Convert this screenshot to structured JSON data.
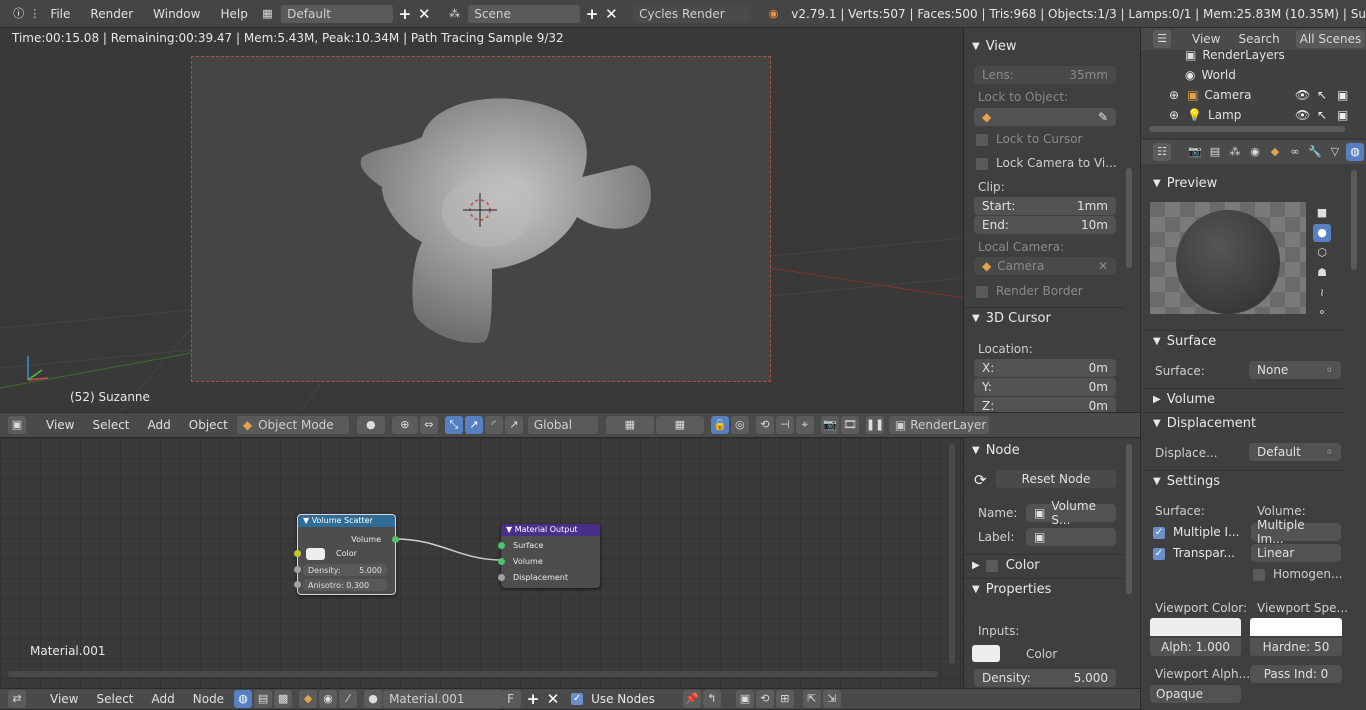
{
  "topbar": {
    "menus": [
      "File",
      "Render",
      "Window",
      "Help"
    ],
    "layout": "Default",
    "scene": "Scene",
    "engine": "Cycles Render",
    "stats": "v2.79.1 | Verts:507 | Faces:500 | Tris:968 | Objects:1/3 | Lamps:0/1 | Mem:25.83M (10.35M) | Su"
  },
  "viewport": {
    "info": "Time:00:15.08 | Remaining:00:39.47 | Mem:5.43M, Peak:10.34M | Path Tracing Sample 9/32",
    "object_label": "(52) Suzanne",
    "header": {
      "menus": [
        "View",
        "Select",
        "Add",
        "Object"
      ],
      "mode": "Object Mode",
      "orientation": "Global",
      "render_layer": "RenderLayer"
    }
  },
  "view_panel": {
    "view_title": "View",
    "lens_label": "Lens:",
    "lens_value": "35mm",
    "lock_to_object": "Lock to Object:",
    "lock_to_cursor": "Lock to Cursor",
    "lock_camera": "Lock Camera to Vi...",
    "clip": "Clip:",
    "start_label": "Start:",
    "start_value": "1mm",
    "end_label": "End:",
    "end_value": "10m",
    "local_camera": "Local Camera:",
    "camera_value": "Camera",
    "render_border": "Render Border",
    "cursor_title": "3D Cursor",
    "location": "Location:",
    "x_label": "X:",
    "x_value": "0m",
    "y_label": "Y:",
    "y_value": "0m",
    "z_label": "Z:",
    "z_value": "0m"
  },
  "outliner": {
    "tabs": [
      "View",
      "Search",
      "All Scenes"
    ],
    "items": [
      "RenderLayers",
      "World",
      "Camera",
      "Lamp"
    ]
  },
  "properties": {
    "preview": "Preview",
    "surface_title": "Surface",
    "surface_label": "Surface:",
    "surface_value": "None",
    "volume_title": "Volume",
    "displacement_title": "Displacement",
    "displace_label": "Displace...",
    "displace_value": "Default",
    "settings_title": "Settings",
    "surface_col": "Surface:",
    "volume_col": "Volume:",
    "multiple_i": "Multiple I...",
    "transpar": "Transpar...",
    "multiple_im": "Multiple Im...",
    "linear": "Linear",
    "homogen": "Homogen...",
    "viewport_color": "Viewport Color:",
    "viewport_spec": "Viewport Spe...",
    "alpha": "Alph: 1.000",
    "hardness": "Hardne: 50",
    "viewport_alpha": "Viewport Alph...",
    "pass_index": "Pass Ind: 0",
    "opaque": "Opaque"
  },
  "node_panel": {
    "node_title": "Node",
    "reset_node": "Reset Node",
    "name_label": "Name:",
    "name_value": "Volume S...",
    "label_label": "Label:",
    "color_title": "Color",
    "properties_title": "Properties",
    "inputs": "Inputs:",
    "color_input": "Color",
    "density_label": "Density:",
    "density_value": "5.000"
  },
  "node_editor": {
    "material_label": "Material.001",
    "volume_scatter": {
      "title": "Volume Scatter",
      "out_volume": "Volume",
      "color": "Color",
      "density": "Density:",
      "density_value": "5.000",
      "anisotropy": "Anisotro: 0.300"
    },
    "material_output": {
      "title": "Material Output",
      "surface": "Surface",
      "volume": "Volume",
      "displacement": "Displacement"
    },
    "header": {
      "menus": [
        "View",
        "Select",
        "Add",
        "Node"
      ],
      "material": "Material.001",
      "fake_user": "F",
      "use_nodes": "Use Nodes"
    }
  },
  "colors": {
    "accent": "#5680c2",
    "volume_header": "#2f6d97",
    "output_header": "#4a2f8a",
    "frame_border": "#b34a4a"
  }
}
